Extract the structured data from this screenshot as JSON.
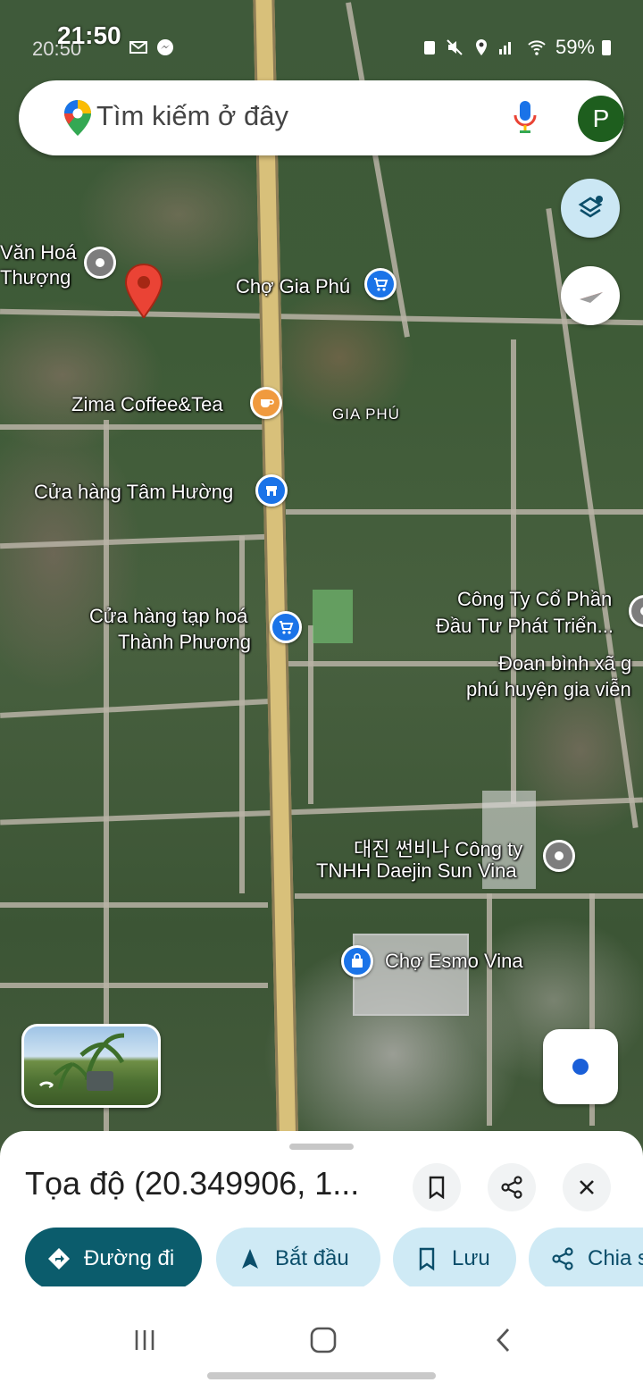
{
  "status_bar": {
    "time": "21:50",
    "time_secondary": "20:50",
    "battery": "59%"
  },
  "search": {
    "placeholder": "Tìm kiếm ở đây",
    "avatar_letter": "P"
  },
  "map_labels": {
    "van_hoa_line1": "Văn Hoá",
    "van_hoa_line2": "Thượng",
    "cho_gia_phu": "Chợ Gia Phú",
    "zima": "Zima Coffee&Tea",
    "gia_phu": "GIA PHÚ",
    "tam_huong": "Cửa hàng Tâm Hường",
    "thanh_phuong_line1": "Cửa hàng tạp hoá",
    "thanh_phuong_line2": "Thành Phương",
    "cong_ty_line1": "Công Ty Cổ Phần",
    "cong_ty_line2": "Đầu Tư Phát Triển...",
    "doan_binh_line1": "Đoan bình xã g",
    "doan_binh_line2": "phú huyện gia viễn",
    "daejin_line1": "대진 썬비나 Công ty",
    "daejin_line2": "TNHH Daejin Sun Vina",
    "cho_esmo": "Chợ Esmo Vina"
  },
  "sheet": {
    "title": "Tọa độ (20.349906, 1...",
    "chips": {
      "directions": "Đường đi",
      "start": "Bắt đầu",
      "save": "Lưu",
      "share": "Chia s"
    }
  },
  "colors": {
    "accent_dark": "#0b5c6c",
    "chip_bg": "#cfeaf5",
    "pin_red": "#ea4335",
    "poi_blue": "#1a73e8",
    "poi_orange": "#f09a3e"
  }
}
